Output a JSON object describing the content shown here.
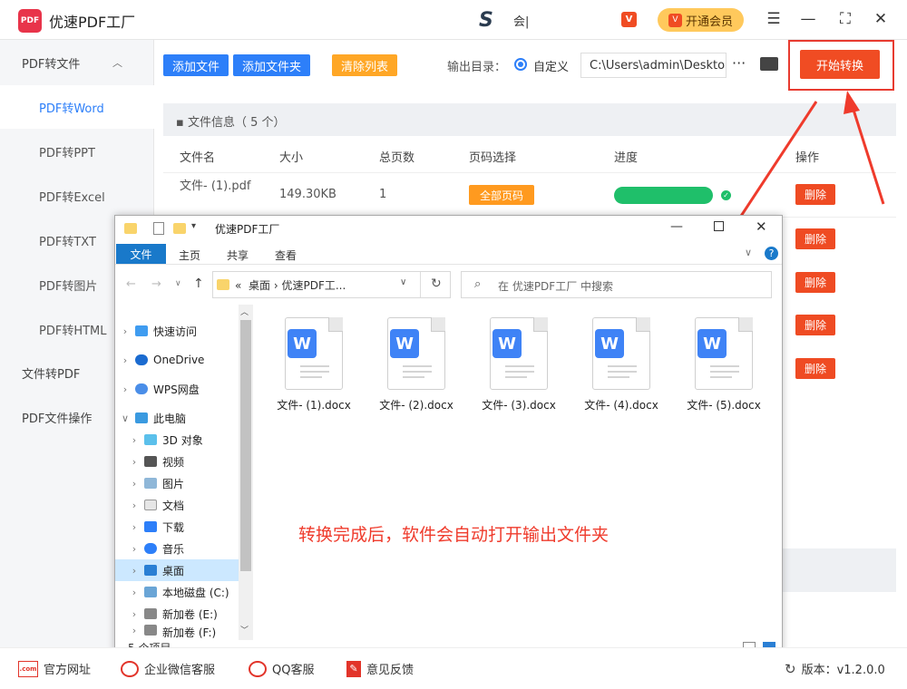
{
  "app": {
    "title": "优速PDF工厂",
    "logo_text": "PDF",
    "s_text": "会|",
    "vip_label": "开通会员"
  },
  "sidebar": [
    {
      "label": "PDF转文件",
      "type": "top",
      "expanded": true
    },
    {
      "label": "PDF转Word",
      "type": "sub",
      "active": true
    },
    {
      "label": "PDF转PPT",
      "type": "sub"
    },
    {
      "label": "PDF转Excel",
      "type": "sub"
    },
    {
      "label": "PDF转TXT",
      "type": "sub"
    },
    {
      "label": "PDF转图片",
      "type": "sub"
    },
    {
      "label": "PDF转HTML",
      "type": "sub"
    },
    {
      "label": "文件转PDF",
      "type": "top"
    },
    {
      "label": "PDF文件操作",
      "type": "top"
    }
  ],
  "toolbar": {
    "add_file": "添加文件",
    "add_folder": "添加文件夹",
    "clear_list": "清除列表",
    "output_label": "输出目录：",
    "custom_label": "自定义",
    "output_path": "C:\\Users\\admin\\Desktop",
    "start": "开始转换"
  },
  "files": {
    "info": "文件信息（ 5 个）",
    "headers": [
      "文件名",
      "大小",
      "总页数",
      "页码选择",
      "进度",
      "操作"
    ],
    "rows": [
      {
        "name": "文件- (1).pdf",
        "size": "149.30KB",
        "pages": "1",
        "page_sel": "全部页码",
        "progress": 1.0,
        "action": "删除"
      }
    ],
    "delete_label": "删除"
  },
  "explorer": {
    "title": "优速PDF工厂",
    "tabs": [
      "文件",
      "主页",
      "共享",
      "查看"
    ],
    "address": [
      "«",
      "桌面",
      "›",
      "优速PDF工..."
    ],
    "search_placeholder": "在 优速PDF工厂 中搜索",
    "nav": [
      {
        "label": "快速访问"
      },
      {
        "label": "OneDrive"
      },
      {
        "label": "WPS网盘"
      },
      {
        "label": "此电脑"
      },
      {
        "label": "3D 对象"
      },
      {
        "label": "视频"
      },
      {
        "label": "图片"
      },
      {
        "label": "文档"
      },
      {
        "label": "下载"
      },
      {
        "label": "音乐"
      },
      {
        "label": "桌面",
        "selected": true
      },
      {
        "label": "本地磁盘 (C:)"
      },
      {
        "label": "新加卷 (E:)"
      },
      {
        "label": "新加卷 (F:)"
      }
    ],
    "files": [
      "文件- (1).docx",
      "文件- (2).docx",
      "文件- (3).docx",
      "文件- (4).docx",
      "文件- (5).docx"
    ],
    "status": "5 个项目"
  },
  "annotation": "转换完成后，软件会自动打开输出文件夹",
  "footer": {
    "website": "官方网址",
    "wechat": "企业微信客服",
    "qq": "QQ客服",
    "feedback": "意见反馈",
    "version": "版本：v1.2.0.0"
  }
}
